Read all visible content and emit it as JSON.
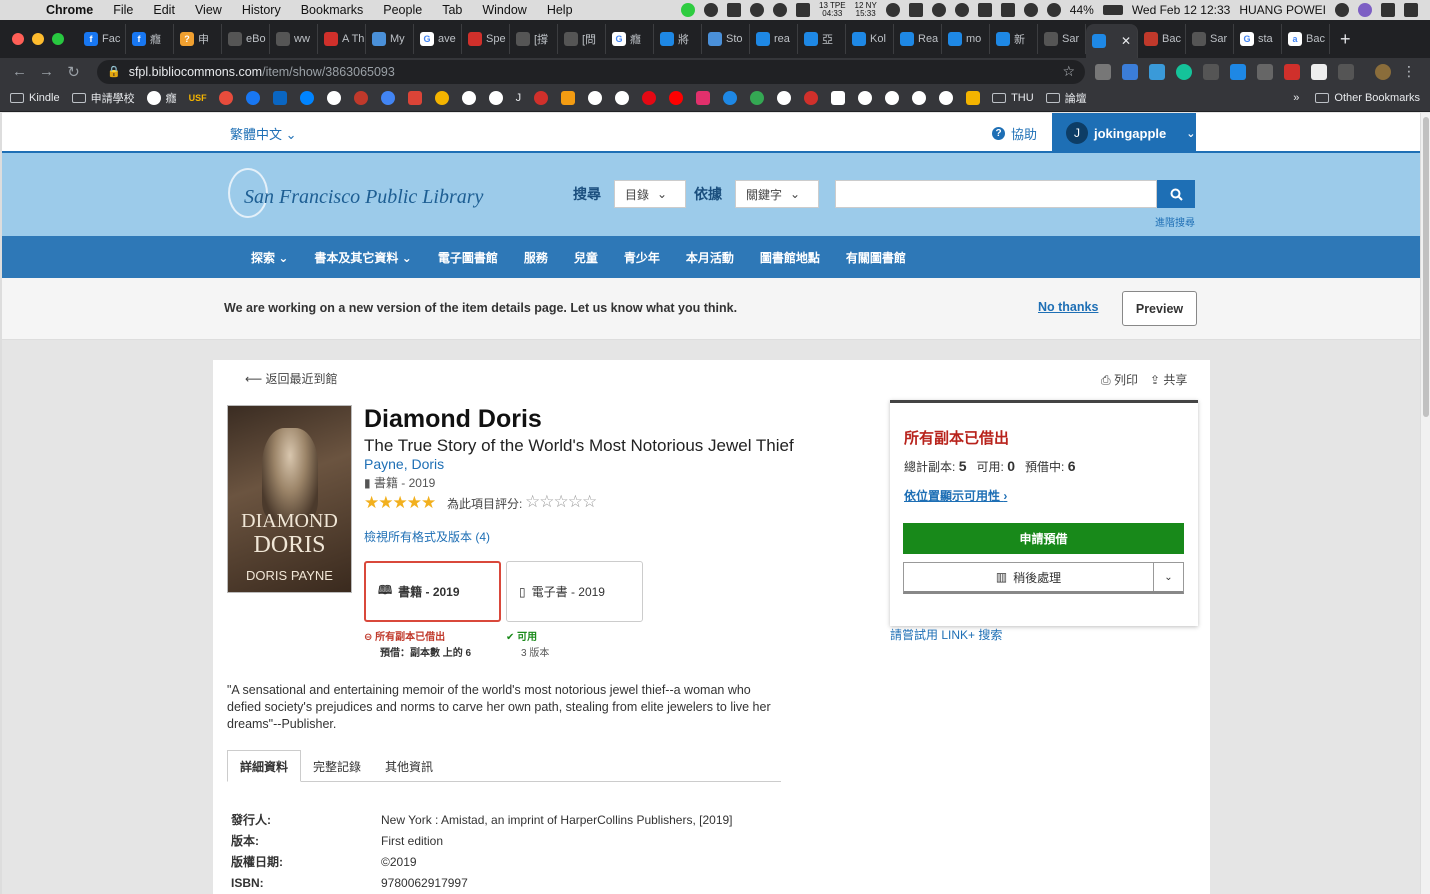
{
  "os_menubar": {
    "app": "Chrome",
    "menus": [
      "File",
      "Edit",
      "View",
      "History",
      "Bookmarks",
      "People",
      "Tab",
      "Window",
      "Help"
    ],
    "clock1_top": "13 TPE",
    "clock1_bottom": "04:33",
    "clock2_top": "12 NY",
    "clock2_bottom": "15:33",
    "battery": "44%",
    "datetime": "Wed Feb 12  12:33",
    "user": "HUANG POWEI"
  },
  "browser": {
    "tabs": [
      {
        "label": "Fac",
        "color": "#1877f2",
        "glyph": "f"
      },
      {
        "label": "癮",
        "color": "#1877f2",
        "glyph": "f"
      },
      {
        "label": "申",
        "color": "#f0a030",
        "glyph": "?"
      },
      {
        "label": "eBo",
        "color": "#555",
        "glyph": ""
      },
      {
        "label": "ww",
        "color": "#555",
        "glyph": ""
      },
      {
        "label": "A Th",
        "color": "#d0302b",
        "glyph": ""
      },
      {
        "label": "My",
        "color": "#4a90d9",
        "glyph": ""
      },
      {
        "label": "ave",
        "color": "#fff",
        "glyph": "G"
      },
      {
        "label": "Spe",
        "color": "#d0302b",
        "glyph": ""
      },
      {
        "label": "[撐",
        "color": "#555",
        "glyph": ""
      },
      {
        "label": "[問",
        "color": "#555",
        "glyph": ""
      },
      {
        "label": "癮",
        "color": "#fff",
        "glyph": "G"
      },
      {
        "label": "將",
        "color": "#1e88e5",
        "glyph": ""
      },
      {
        "label": "Sto",
        "color": "#4a90d9",
        "glyph": ""
      },
      {
        "label": "rea",
        "color": "#1e88e5",
        "glyph": ""
      },
      {
        "label": "亞",
        "color": "#1e88e5",
        "glyph": ""
      },
      {
        "label": "Kol",
        "color": "#1e88e5",
        "glyph": ""
      },
      {
        "label": "Rea",
        "color": "#1e88e5",
        "glyph": ""
      },
      {
        "label": "mo",
        "color": "#1e88e5",
        "glyph": ""
      },
      {
        "label": "新",
        "color": "#1e88e5",
        "glyph": ""
      },
      {
        "label": "Sar",
        "color": "#555",
        "glyph": ""
      },
      {
        "label": "",
        "color": "#1e88e5",
        "glyph": "",
        "active": true
      },
      {
        "label": "Bac",
        "color": "#c0392b",
        "glyph": ""
      },
      {
        "label": "Sar",
        "color": "#555",
        "glyph": ""
      },
      {
        "label": "sta",
        "color": "#fff",
        "glyph": "G"
      },
      {
        "label": "Bac",
        "color": "#fff",
        "glyph": "a"
      }
    ],
    "url_host": "sfpl.bibliocommons.com",
    "url_path": "/item/show/3863065093",
    "bookmarks_left": [
      "Kindle",
      "申請學校"
    ],
    "bookmarks_mid": [
      "癮",
      "USF"
    ],
    "bookmarks_short": [
      "J",
      "THU",
      "論壇"
    ],
    "bookmark_icon_colors": [
      "#e74c3c",
      "#1877f2",
      "#0a66c2",
      "#0084ff",
      "#fff",
      "#c0392b",
      "#4285f4",
      "#db4437",
      "#f4b400",
      "#fff",
      "#fff",
      "#d0302b",
      "#f39c12",
      "#fff",
      "#fff",
      "#e50914",
      "#ff0000",
      "#e1306c",
      "#1e88e5",
      "#34a853",
      "#fff",
      "#d0302b",
      "#fff",
      "#fff",
      "#fff",
      "#fff",
      "#fff",
      "#f4b400"
    ],
    "other_bookmarks": "Other Bookmarks"
  },
  "site": {
    "language": "繁體中文",
    "help": "協助",
    "user_initial": "J",
    "username": "jokingapple",
    "logo_text": "San Francisco Public Library",
    "search_label": "搜尋",
    "search_scope": "目錄",
    "search_by_label": "依據",
    "search_by": "關鍵字",
    "search_value": "",
    "advanced_search": "進階搜尋",
    "nav": [
      "探索",
      "書本及其它資料",
      "電子圖書館",
      "服務",
      "兒童",
      "青少年",
      "本月活動",
      "圖書館地點",
      "有關圖書館"
    ],
    "notice": "We are working on a new version of the item details page. Let us know what you think.",
    "no_thanks": "No thanks",
    "preview": "Preview"
  },
  "item": {
    "back": "返回最近到館",
    "print": "列印",
    "share": "共享",
    "cover_title_1": "DIAMOND",
    "cover_title_2": "DORIS",
    "cover_author": "DORIS PAYNE",
    "title": "Diamond Doris",
    "subtitle": "The True Story of the World's Most Notorious Jewel Thief",
    "author": "Payne, Doris",
    "format_year": "書籍 - 2019",
    "rating": 5,
    "rate_label": "為此項目評分:",
    "all_formats": "檢視所有格式及版本 (4)",
    "format_options": [
      {
        "label": "書籍 - 2019",
        "status": "所有副本已借出",
        "sub": "預借：副本數 上的 6"
      },
      {
        "label": "電子書 - 2019",
        "status": "可用",
        "sub": "3 版本"
      }
    ],
    "description": "\"A sensational and entertaining memoir of the world's most notorious jewel thief--a woman who defied society's prejudices and norms to carve her own path, stealing from elite jewelers to live her dreams\"--Publisher.",
    "tabs": [
      "詳細資料",
      "完整記錄",
      "其他資訊"
    ],
    "details": [
      {
        "k": "發行人:",
        "v": "New York : Amistad, an imprint of HarperCollins Publishers, [2019]"
      },
      {
        "k": "版本:",
        "v": "First edition"
      },
      {
        "k": "版權日期:",
        "v": "©2019"
      },
      {
        "k": "ISBN:",
        "v": "9780062917997"
      }
    ]
  },
  "availability": {
    "heading": "所有副本已借出",
    "total_label": "總計副本:",
    "total": "5",
    "available_label": "可用:",
    "available": "0",
    "holds_label": "預借中:",
    "holds": "6",
    "by_location": "依位置顯示可用性",
    "place_hold": "申請預借",
    "for_later": "稍後處理",
    "link_plus": "請嘗試用 LINK+ 搜索"
  }
}
